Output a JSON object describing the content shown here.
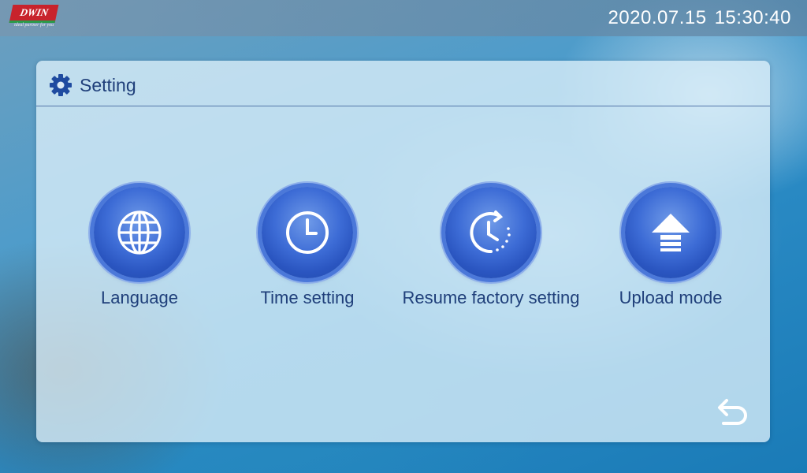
{
  "header": {
    "logo_text": "DWIN",
    "logo_tagline": "ideal partner for you",
    "date": "2020.07.15",
    "time": "15:30:40"
  },
  "panel": {
    "title": "Setting",
    "title_icon": "gear-icon",
    "items": [
      {
        "label": "Language",
        "icon": "globe-icon"
      },
      {
        "label": "Time setting",
        "icon": "clock-icon"
      },
      {
        "label": "Resume factory setting",
        "icon": "restore-clock-icon"
      },
      {
        "label": "Upload mode",
        "icon": "upload-arrow-icon"
      }
    ],
    "back_icon": "back-arrow-icon"
  },
  "colors": {
    "accent_blue": "#2a55c0",
    "title_text": "#1f3f7a",
    "logo_red": "#c8232c"
  }
}
